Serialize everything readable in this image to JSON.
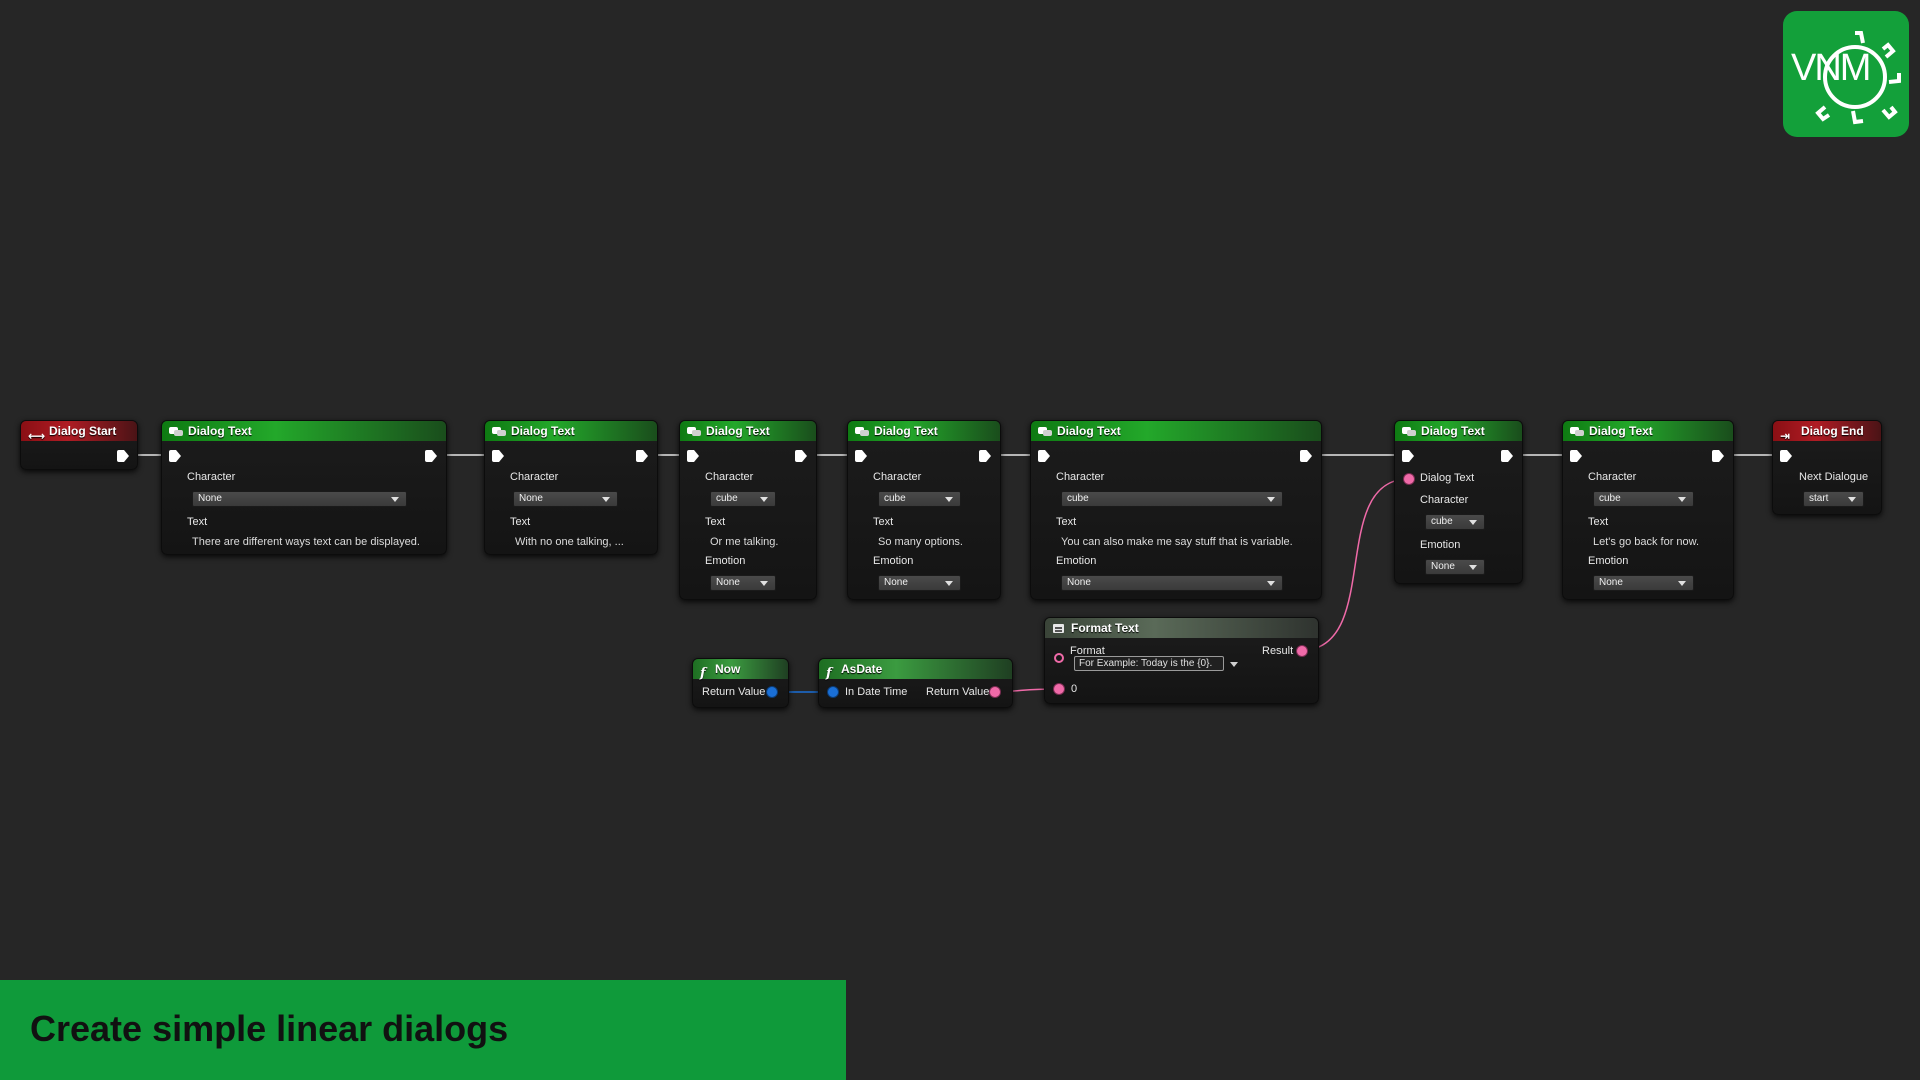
{
  "graph": {
    "dialog_start": {
      "title": "Dialog Start"
    },
    "dialog_end": {
      "title": "Dialog End",
      "next_label": "Next Dialogue",
      "next_value": "start"
    },
    "nodes": [
      {
        "title": "Dialog Text",
        "character_label": "Character",
        "character": "None",
        "text_label": "Text",
        "text": "There are different ways text can be displayed."
      },
      {
        "title": "Dialog Text",
        "character_label": "Character",
        "character": "None",
        "text_label": "Text",
        "text": "With no one talking, ..."
      },
      {
        "title": "Dialog Text",
        "character_label": "Character",
        "character": "cube",
        "text_label": "Text",
        "text": "Or me talking.",
        "emotion_label": "Emotion",
        "emotion": "None"
      },
      {
        "title": "Dialog Text",
        "character_label": "Character",
        "character": "cube",
        "text_label": "Text",
        "text": "So many options.",
        "emotion_label": "Emotion",
        "emotion": "None"
      },
      {
        "title": "Dialog Text",
        "character_label": "Character",
        "character": "cube",
        "text_label": "Text",
        "text": "You can also make me say stuff that is variable.",
        "emotion_label": "Emotion",
        "emotion": "None"
      },
      {
        "title": "Dialog Text",
        "dialog_text_label": "Dialog Text",
        "character_label": "Character",
        "character": "cube",
        "emotion_label": "Emotion",
        "emotion": "None"
      },
      {
        "title": "Dialog Text",
        "character_label": "Character",
        "character": "cube",
        "text_label": "Text",
        "text": "Let's go back for now.",
        "emotion_label": "Emotion",
        "emotion": "None"
      }
    ],
    "format_text": {
      "title": "Format Text",
      "format_label": "Format",
      "format_value": "For Example: Today is the {0}.",
      "result_label": "Result",
      "arg_label": "0"
    },
    "now": {
      "title": "Now",
      "return_label": "Return Value"
    },
    "as_date": {
      "title": "AsDate",
      "input_label": "In Date Time",
      "return_label": "Return Value"
    }
  },
  "logo": {
    "text": "VNM"
  },
  "banner": {
    "title": "Create simple linear dialogs"
  },
  "colors": {
    "banner_green": "#0f9a3a",
    "header_green": "#23a82a",
    "header_red": "#b01c24",
    "string_pin": "#ef6aa8",
    "datetime_pin": "#1a6fd6"
  }
}
